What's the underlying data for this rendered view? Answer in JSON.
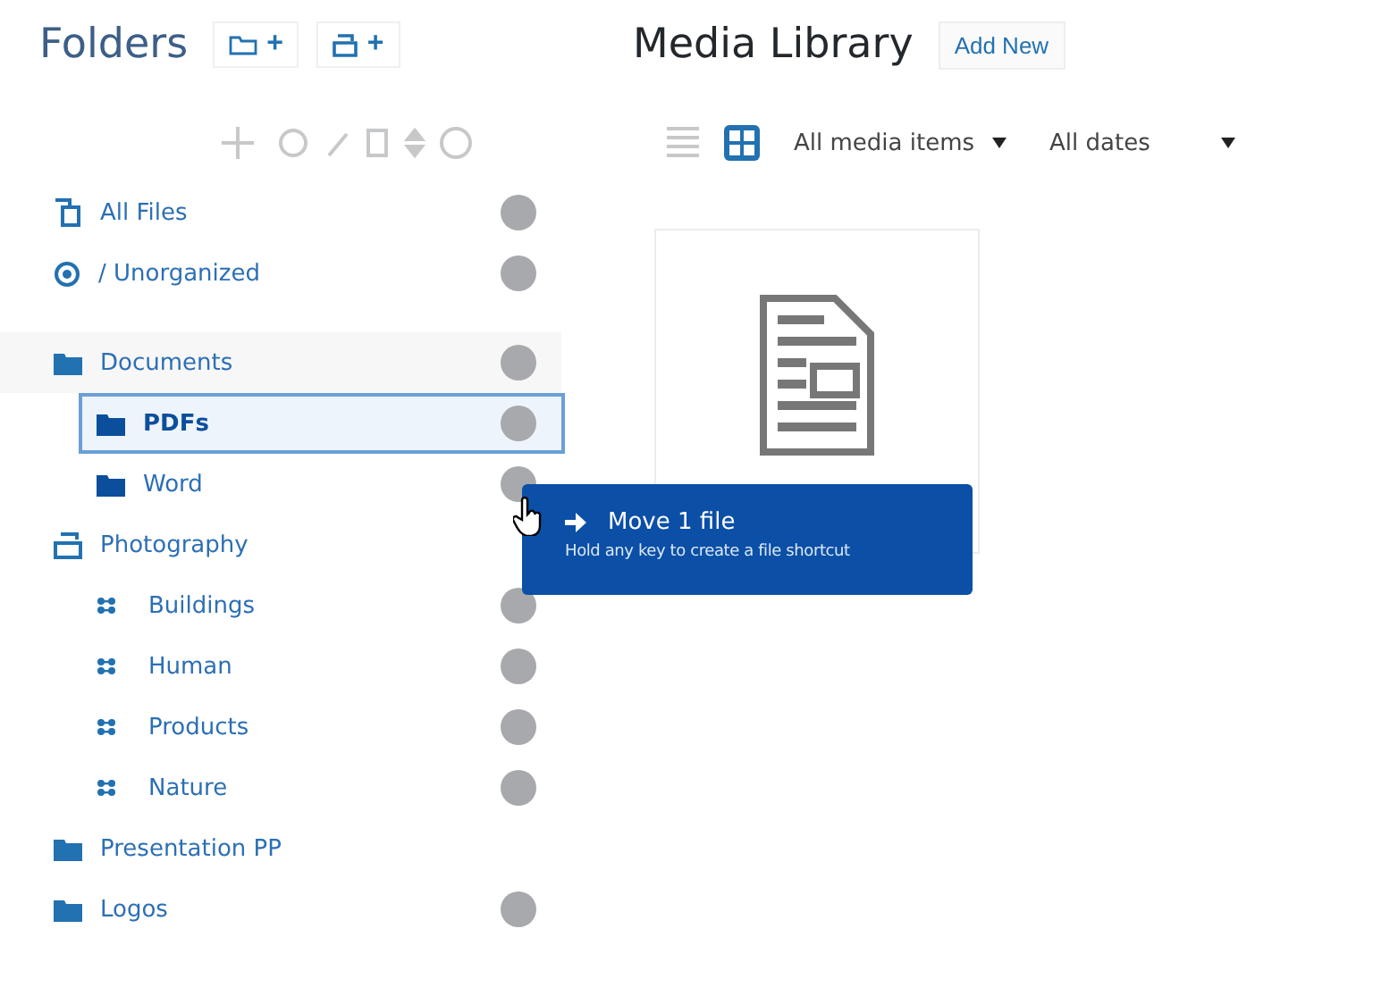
{
  "folders_panel": {
    "title": "Folders",
    "add_buttons": [
      {
        "kind": "folder",
        "label": "+"
      },
      {
        "kind": "category",
        "label": "+"
      }
    ],
    "toolbar_disabled": true,
    "tree": [
      {
        "label": "All Files",
        "kind": "all",
        "selected": false,
        "count_badge": true
      },
      {
        "label": "/ Unorganized",
        "kind": "unorganized",
        "selected": false,
        "count_badge": true
      },
      {
        "label": "Documents",
        "kind": "folder",
        "selected": false,
        "count_badge": true,
        "children": [
          {
            "label": "PDFs",
            "kind": "folder",
            "selected": true,
            "count_badge": true
          },
          {
            "label": "Word",
            "kind": "folder",
            "selected": false,
            "count_badge": true
          }
        ]
      },
      {
        "label": "Photography",
        "kind": "category",
        "selected": false,
        "count_badge": false,
        "children": [
          {
            "label": "Buildings",
            "kind": "tag",
            "selected": false,
            "count_badge": true
          },
          {
            "label": "Human",
            "kind": "tag",
            "selected": false,
            "count_badge": true
          },
          {
            "label": "Products",
            "kind": "tag",
            "selected": false,
            "count_badge": true
          },
          {
            "label": "Nature",
            "kind": "tag",
            "selected": false,
            "count_badge": true
          }
        ]
      },
      {
        "label": "Presentation PP",
        "kind": "folder",
        "selected": false,
        "count_badge": false
      },
      {
        "label": "Logos",
        "kind": "folder",
        "selected": false,
        "count_badge": true
      }
    ]
  },
  "media": {
    "title": "Media Library",
    "add_new": "Add New",
    "views": [
      {
        "kind": "list",
        "selected": false
      },
      {
        "kind": "grid",
        "selected": true
      }
    ],
    "filters": [
      "All media items",
      "All dates"
    ]
  },
  "drag_tooltip": {
    "title": "Move 1 file",
    "hint": "Hold any key to create a file shortcut"
  }
}
